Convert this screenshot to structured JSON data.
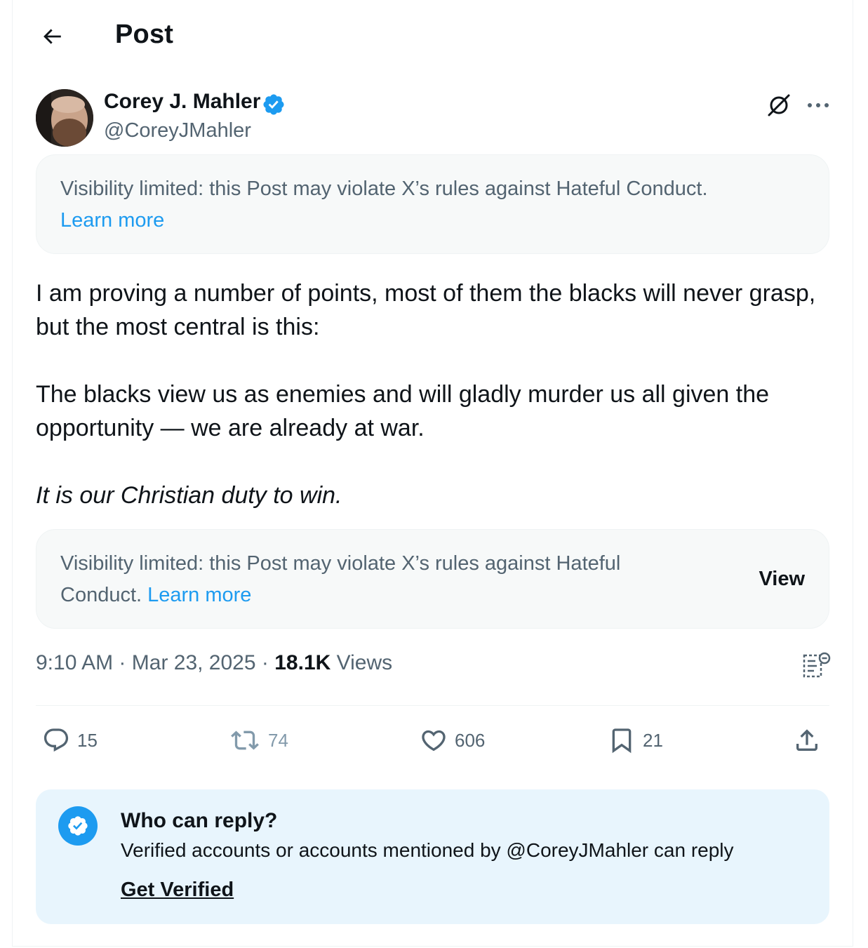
{
  "header": {
    "title": "Post",
    "back_icon": "arrow-left-icon"
  },
  "author": {
    "name": "Corey J. Mahler",
    "handle": "@CoreyJMahler",
    "verified": true,
    "badge_color": "#1d9bf0"
  },
  "notice_top": {
    "text": "Visibility limited: this Post may violate X’s rules against Hateful Conduct.",
    "link": "Learn more"
  },
  "tweet": {
    "paragraphs": [
      "I am proving a number of points, most of them the blacks will never grasp, but the most central is this:",
      "The blacks view us as enemies and will gladly murder us all given the opportunity — we are already at war.",
      "It is our Christian duty to win."
    ]
  },
  "notice_bottom": {
    "text": "Visibility limited: this Post may violate X’s rules against Hateful Conduct.",
    "link": "Learn more",
    "button": "View"
  },
  "meta": {
    "time": "9:10 AM",
    "date": "Mar 23, 2025",
    "views_count": "18.1K",
    "views_label": "Views",
    "separator": "·"
  },
  "actions": {
    "replies": "15",
    "reposts": "74",
    "likes": "606",
    "bookmarks": "21"
  },
  "reply_restriction": {
    "title": "Who can reply?",
    "subtitle": "Verified accounts or accounts mentioned by @CoreyJMahler can reply",
    "cta": "Get Verified"
  },
  "colors": {
    "accent": "#1d9bf0",
    "muted_text": "#536471",
    "notice_bg": "#f7f9f9",
    "reply_box_bg": "#e8f5fd",
    "repost_icon": "#829aab"
  }
}
